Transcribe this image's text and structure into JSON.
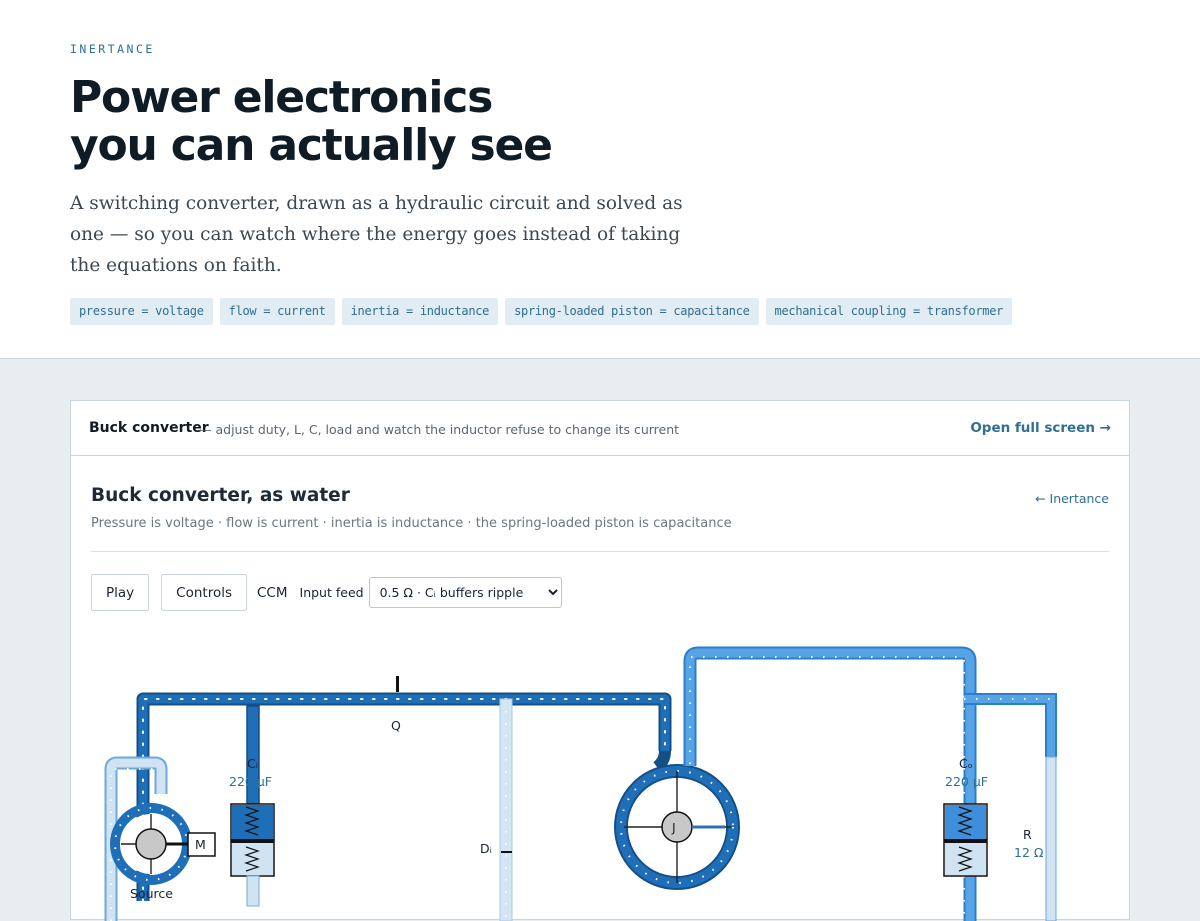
{
  "hero": {
    "eyebrow": "INERTANCE",
    "title_line1": "Power electronics",
    "title_line2": "you can actually see",
    "lede": "A switching converter, drawn as a hydraulic circuit and solved as one — so you can watch where the energy goes instead of taking the equations on faith.",
    "chips": [
      "pressure = voltage",
      "flow = current",
      "inertia = inductance",
      "spring-loaded piston = capacitance",
      "mechanical coupling = transformer"
    ]
  },
  "card": {
    "name": "Buck converter",
    "description": "— adjust duty, L, C, load and watch the inductor refuse to change its current",
    "open_label": "Open full screen →"
  },
  "sim": {
    "title": "Buck converter, as water",
    "subtitle": "Pressure is voltage · flow is current · inertia is inductance · the spring-loaded piston is capacitance",
    "back_label": "← Inertance",
    "play_label": "Play",
    "controls_label": "Controls",
    "mode": "CCM",
    "feed_label": "Input feed",
    "feed_selected": "0.5 Ω · Cᵢ buffers ripple"
  },
  "diagram": {
    "q_label": "Q",
    "cin_label": "Cᵢ",
    "cin_value": "220 μF",
    "cout_label": "Cₒ",
    "cout_value": "220 μF",
    "diode_label": "Dᵢ",
    "motor_label": "M",
    "source_label": "Source",
    "inductor_label": "J",
    "load_label": "R",
    "load_value": "12 Ω",
    "colors": {
      "pipe_dark": "#1f6fb8",
      "pipe_mid": "#3d8fdb",
      "pipe_light": "#d3e6f4"
    }
  }
}
